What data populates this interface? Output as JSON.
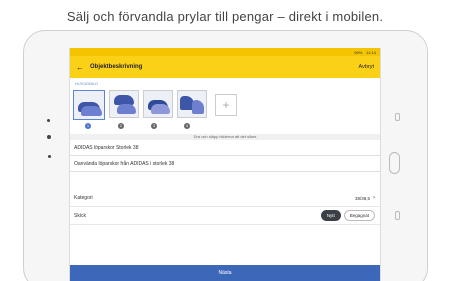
{
  "promo": {
    "text": "Sälj och förvandla prylar till pengar – direkt i mobilen."
  },
  "statusbar": {
    "battery": "96%",
    "time": "11:14"
  },
  "appbar": {
    "back_icon": "arrow-back-icon",
    "title": "Objektbeskrivning",
    "cancel_label": "Avbryt"
  },
  "photos": {
    "tab_label": "HUVUDBILD",
    "items": [
      {
        "number": "1"
      },
      {
        "number": "2"
      },
      {
        "number": "3"
      },
      {
        "number": "4"
      }
    ],
    "add_label": "+",
    "hint": "Dra och släpp bilderna att det ulkes"
  },
  "form": {
    "title_value": "ADIDAS löparskor Storlek 38",
    "description_value": "Oanvända löparskor från ADIDAS i storlek 38",
    "category_label": "Kategori",
    "category_value": "38/38,5",
    "condition_label": "Skick",
    "condition_options": [
      "Nytt",
      "Begagnat"
    ]
  },
  "footer": {
    "next_label": "Nästa"
  },
  "colors": {
    "accent": "#fbd117",
    "primary": "#3d67b9"
  }
}
